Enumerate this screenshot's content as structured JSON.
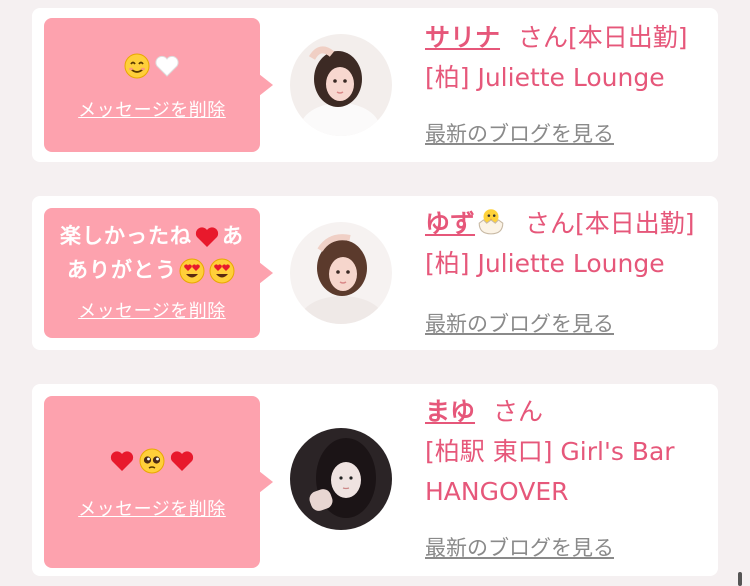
{
  "cards": [
    {
      "message": "",
      "emojis": [
        "smiling-face-emoji",
        "white-heart-emoji"
      ],
      "delete_label": "メッセージを削除",
      "name": "サリナ",
      "suffix": "さん[本日出勤]",
      "shop": "[柏] Juliette Lounge",
      "blog_link": "最新のブログを見る"
    },
    {
      "message_line1": "楽しかったね",
      "message_line2": "ありがとう",
      "delete_label": "メッセージを削除",
      "name": "ゆず",
      "name_emoji": "hatching-chick-emoji",
      "suffix": "さん[本日出勤]",
      "shop": "[柏] Juliette Lounge",
      "blog_link": "最新のブログを見る"
    },
    {
      "message": "",
      "emojis": [
        "red-heart-emoji",
        "pleading-face-emoji",
        "red-heart-emoji"
      ],
      "delete_label": "メッセージを削除",
      "name": "まゆ",
      "suffix": "さん",
      "shop": "[柏駅 東口] Girl's Bar HANGOVER",
      "blog_link": "最新のブログを見る"
    }
  ],
  "colors": {
    "bubble": "#fda2ae",
    "accent": "#e6577a",
    "link_gray": "#8a8a8a",
    "background": "#f5f0f1"
  }
}
